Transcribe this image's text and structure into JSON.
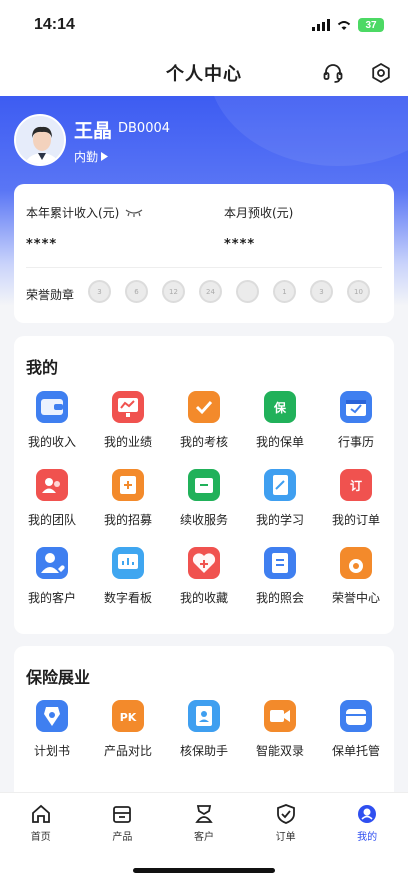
{
  "status": {
    "time": "14:14",
    "battery": "37"
  },
  "nav": {
    "title": "个人中心"
  },
  "user": {
    "name": "王晶",
    "code": "DB0004",
    "type": "内勤"
  },
  "income": {
    "year_label": "本年累计收入(元)",
    "year_value": "****",
    "month_label": "本月预收(元)",
    "month_value": "****"
  },
  "honor": {
    "label": "荣誉勋章",
    "medals": [
      "3",
      "6",
      "12",
      "24",
      "",
      "1",
      "3",
      "10"
    ]
  },
  "mine": {
    "title": "我的",
    "items": [
      {
        "label": "我的收入",
        "icon": "wallet-icon",
        "color": "#3f7ff0"
      },
      {
        "label": "我的业绩",
        "icon": "chart-icon",
        "color": "#f0524f"
      },
      {
        "label": "我的考核",
        "icon": "check-shield-icon",
        "color": "#f38a2b"
      },
      {
        "label": "我的保单",
        "icon": "policy-shield-icon",
        "color": "#21b15a"
      },
      {
        "label": "行事历",
        "icon": "calendar-icon",
        "color": "#3f7ff0"
      },
      {
        "label": "我的团队",
        "icon": "team-icon",
        "color": "#f0524f"
      },
      {
        "label": "我的招募",
        "icon": "recruit-icon",
        "color": "#f38a2b"
      },
      {
        "label": "续收服务",
        "icon": "renew-icon",
        "color": "#21b15a"
      },
      {
        "label": "我的学习",
        "icon": "study-icon",
        "color": "#3f9ff0"
      },
      {
        "label": "我的订单",
        "icon": "order-icon",
        "color": "#f0524f"
      },
      {
        "label": "我的客户",
        "icon": "customer-icon",
        "color": "#3f7ff0"
      },
      {
        "label": "数字看板",
        "icon": "dashboard-icon",
        "color": "#3fa6f0"
      },
      {
        "label": "我的收藏",
        "icon": "favorite-icon",
        "color": "#f0524f"
      },
      {
        "label": "我的照会",
        "icon": "notice-icon",
        "color": "#3f7ff0"
      },
      {
        "label": "荣誉中心",
        "icon": "medal-icon",
        "color": "#f38a2b"
      }
    ]
  },
  "insure": {
    "title": "保险展业",
    "items": [
      {
        "label": "计划书",
        "icon": "plan-icon",
        "color": "#3f7ff0"
      },
      {
        "label": "产品对比",
        "icon": "pk-icon",
        "color": "#f38a2b"
      },
      {
        "label": "核保助手",
        "icon": "underwrite-icon",
        "color": "#3f9ff0"
      },
      {
        "label": "智能双录",
        "icon": "video-icon",
        "color": "#f38a2b"
      },
      {
        "label": "保单托管",
        "icon": "custody-icon",
        "color": "#3f7ff0"
      }
    ]
  },
  "tabs": [
    {
      "label": "首页",
      "icon": "home-icon"
    },
    {
      "label": "产品",
      "icon": "product-icon"
    },
    {
      "label": "客户",
      "icon": "customer-tab-icon"
    },
    {
      "label": "订单",
      "icon": "order-tab-icon"
    },
    {
      "label": "我的",
      "icon": "profile-icon",
      "active": true
    }
  ]
}
